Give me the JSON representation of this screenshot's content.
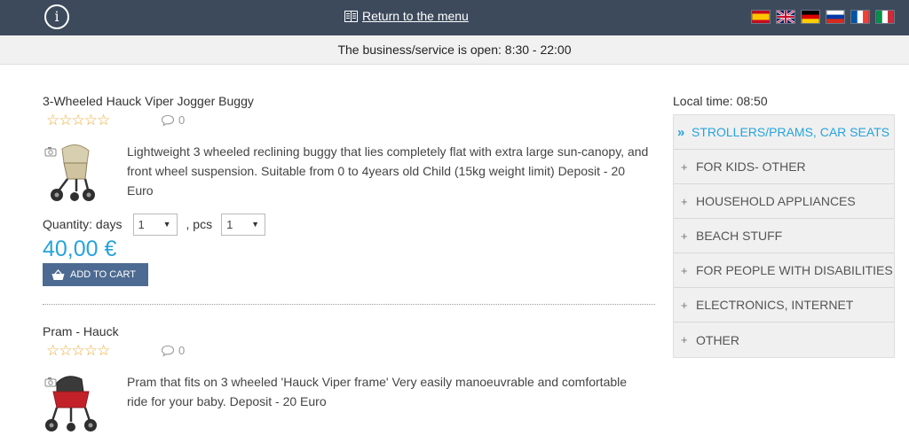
{
  "topbar": {
    "info_label": "i",
    "menu_link": "Return to the menu",
    "languages": [
      "Spanish",
      "English",
      "German",
      "Russian",
      "French",
      "Italian"
    ]
  },
  "hours_text": "The business/service is open: 8:30 - 22:00",
  "products": [
    {
      "title": "3-Wheeled Hauck Viper Jogger Buggy",
      "stars": "☆☆☆☆☆",
      "comments": "0",
      "description": "Lightweight 3 wheeled reclining buggy that lies completely flat with extra large sun-canopy, and front wheel suspension. Suitable from 0 to 4years old Child (15kg weight limit) Deposit - 20 Euro",
      "quantity_label": "Quantity: days",
      "days_value": "1",
      "pcs_label": ", pcs",
      "pcs_value": "1",
      "price": "40,00 €",
      "add_to_cart": "ADD TO CART"
    },
    {
      "title": "Pram - Hauck",
      "stars": "☆☆☆☆☆",
      "comments": "0",
      "description": "Pram that fits on 3 wheeled 'Hauck Viper frame' Very easily manoeuvrable and comfortable ride for your baby. Deposit - 20 Euro"
    }
  ],
  "sidebar": {
    "local_time": "Local time: 08:50",
    "categories": [
      {
        "label": "STROLLERS/PRAMS, CAR SEATS",
        "icon": "»"
      },
      {
        "label": "FOR KIDS- OTHER",
        "icon": "+"
      },
      {
        "label": "HOUSEHOLD APPLIANCES",
        "icon": "+"
      },
      {
        "label": "BEACH STUFF",
        "icon": "+"
      },
      {
        "label": "FOR PEOPLE WITH DISABILITIES",
        "icon": "+"
      },
      {
        "label": "ELECTRONICS, INTERNET",
        "icon": "+"
      },
      {
        "label": "OTHER",
        "icon": "+"
      }
    ]
  },
  "colors": {
    "topbar": "#3d4a5c",
    "accent": "#25a4dc",
    "cart_button": "#4d6b92",
    "stars": "#f0a833"
  }
}
